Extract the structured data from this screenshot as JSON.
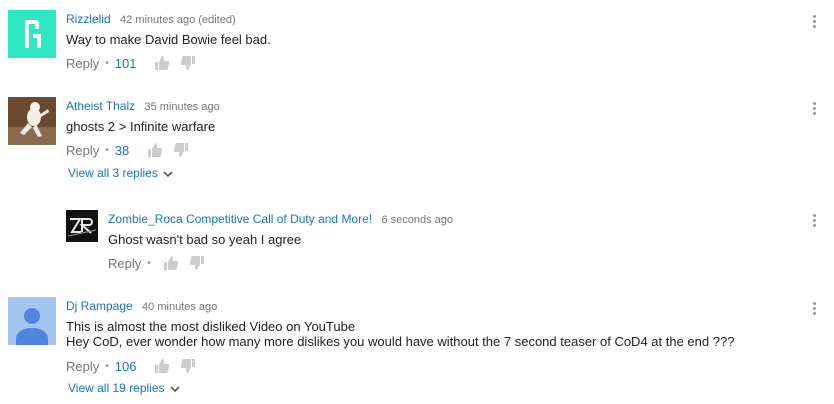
{
  "comments": [
    {
      "author": "Rizzlelid",
      "time": "42 minutes ago (edited)",
      "text": [
        "Way to make David Bowie feel bad."
      ],
      "reply_label": "Reply",
      "likes": "101",
      "avatar_color": "#2ee6c0",
      "view_replies": null
    },
    {
      "author": "Atheist Thalz",
      "time": "35 minutes ago",
      "text": [
        "ghosts 2 > Infinite warfare"
      ],
      "reply_label": "Reply",
      "likes": "38",
      "avatar_color": "#5a3e2a",
      "view_replies": "View all 3 replies"
    },
    {
      "author": "Zombie_Roca Competitive Call of Duty and More!",
      "time": "6 seconds ago",
      "text": [
        "Ghost wasn't bad so yeah I agree"
      ],
      "reply_label": "Reply",
      "likes": "",
      "avatar_color": "#111111",
      "avatar_letters": "ZR",
      "is_reply": true
    },
    {
      "author": "Dj Rampage",
      "time": "40 minutes ago",
      "text": [
        "This is almost the most disliked Video on YouTube",
        "Hey CoD, ever wonder how many more dislikes you would have without the 7 second teaser of CoD4 at the end ???"
      ],
      "reply_label": "Reply",
      "likes": "106",
      "avatar_color": "#9fc0ee",
      "view_replies": "View all 19 replies"
    }
  ],
  "colors": {
    "link": "#1a73c9",
    "muted": "#767676",
    "icon": "#cccccc"
  }
}
